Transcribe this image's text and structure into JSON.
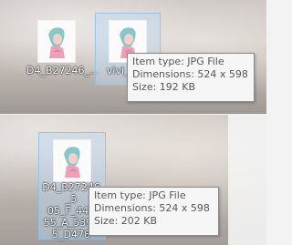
{
  "top_panel": {
    "files": [
      {
        "name": "D4_B27246_...",
        "selected": false
      },
      {
        "name": "vivi_1siz",
        "selected": true
      }
    ],
    "tooltip": {
      "item_type": "Item type: JPG File",
      "dimensions": "Dimensions: 524 x 598",
      "size": "Size: 192 KB"
    }
  },
  "bottom_panel": {
    "files": [
      {
        "name_lines": [
          "D4_B27246_5",
          "05_F_447",
          "55_A_5392",
          "5_D478"
        ],
        "selected": true
      }
    ],
    "tooltip": {
      "item_type": "Item type: JPG File",
      "dimensions": "Dimensions: 524 x 598",
      "size": "Size: 202 KB"
    }
  },
  "colors": {
    "selection_fill": "#b7d6f1",
    "selection_border": "#8dbfe8",
    "tooltip_bg": "#f6f6f6",
    "tooltip_border": "#8b8b8b",
    "tooltip_text": "#575757"
  },
  "icons": {
    "thumbnail": "anime-girl-illustration-thumbnail"
  }
}
